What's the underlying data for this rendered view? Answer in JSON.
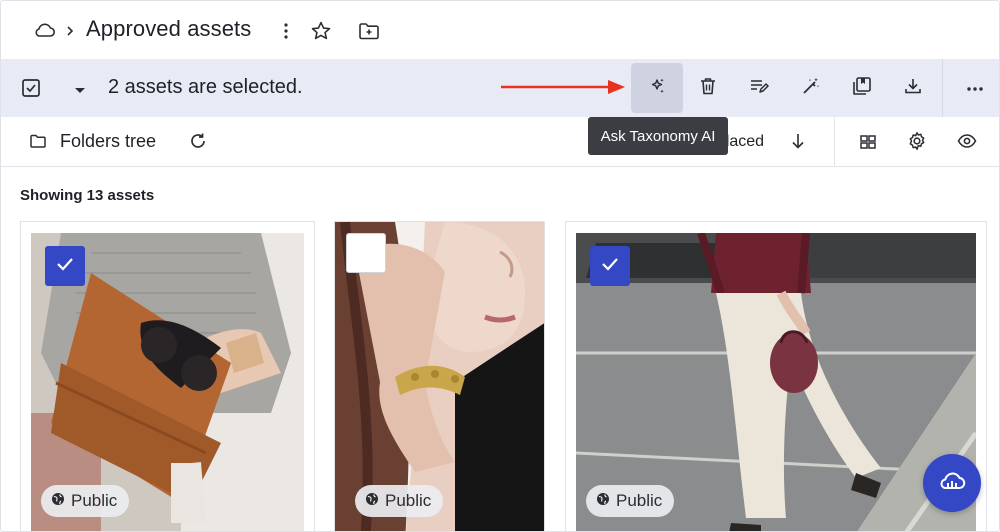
{
  "header": {
    "title": "Approved assets",
    "icons": [
      "cloud-icon",
      "chevron-right-icon",
      "kebab-icon",
      "star-icon",
      "folder-plus-icon"
    ]
  },
  "selection_bar": {
    "text": "2 assets are selected.",
    "toolbar": [
      "ai-sparkle-icon",
      "trash-icon",
      "edit-metadata-icon",
      "magic-wand-icon",
      "copy-icon",
      "download-icon",
      "more-icon"
    ]
  },
  "tooltip": {
    "text": "Ask Taxonomy AI"
  },
  "filters": {
    "folder_tree_label": "Folders tree",
    "sort_label": "Last replaced"
  },
  "asset_count": "Showing 13 assets",
  "assets": [
    {
      "selected": true,
      "visibility": "Public"
    },
    {
      "selected": false,
      "visibility": "Public"
    },
    {
      "selected": true,
      "visibility": "Public"
    }
  ],
  "colors": {
    "accent": "#3448c5",
    "selection_bar_bg": "#e8eaf6",
    "annotation_arrow": "#e8321e",
    "tooltip_bg": "#3b3d42"
  }
}
